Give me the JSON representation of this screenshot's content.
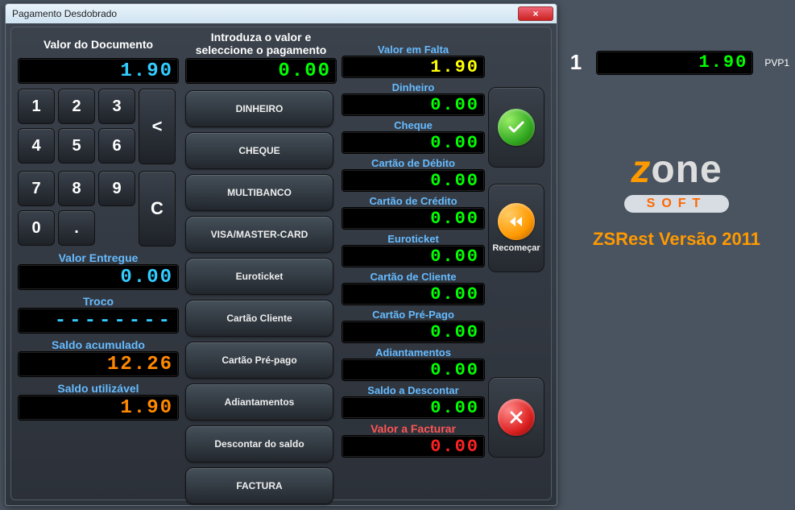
{
  "window": {
    "title": "Pagamento Desdobrado",
    "close": "×"
  },
  "col1": {
    "header": "Valor do Documento",
    "doc_value": "1.90",
    "keys": {
      "k1": "1",
      "k2": "2",
      "k3": "3",
      "k4": "4",
      "k5": "5",
      "k6": "6",
      "k7": "7",
      "k8": "8",
      "k9": "9",
      "k0": "0",
      "kdot": ".",
      "back": "<",
      "clear": "C"
    },
    "delivered_label": "Valor Entregue",
    "delivered_value": "0.00",
    "change_label": "Troco",
    "change_value": "--------",
    "accum_label": "Saldo acumulado",
    "accum_value": "12.26",
    "usable_label": "Saldo utilizável",
    "usable_value": "1.90"
  },
  "col2": {
    "header_line1": "Introduza o valor e",
    "header_line2": "seleccione o pagamento",
    "input_value": "0.00",
    "buttons": {
      "b1": "DINHEIRO",
      "b2": "CHEQUE",
      "b3": "MULTIBANCO",
      "b4": "VISA/MASTER-CARD",
      "b5": "Euroticket",
      "b6": "Cartão Cliente",
      "b7": "Cartão Pré-pago",
      "b8": "Adiantamentos",
      "b9": "Descontar do saldo",
      "b10": "FACTURA"
    }
  },
  "col3": {
    "rows": [
      {
        "label": "Valor em Falta",
        "value": "1.90",
        "color": "yellow"
      },
      {
        "label": "Dinheiro",
        "value": "0.00",
        "color": "green"
      },
      {
        "label": "Cheque",
        "value": "0.00",
        "color": "green"
      },
      {
        "label": "Cartão de Débito",
        "value": "0.00",
        "color": "green"
      },
      {
        "label": "Cartão de Crédito",
        "value": "0.00",
        "color": "green"
      },
      {
        "label": "Euroticket",
        "value": "0.00",
        "color": "green"
      },
      {
        "label": "Cartão de Cliente",
        "value": "0.00",
        "color": "green"
      },
      {
        "label": "Cartão Pré-Pago",
        "value": "0.00",
        "color": "green"
      },
      {
        "label": "Adiantamentos",
        "value": "0.00",
        "color": "green"
      },
      {
        "label": "Saldo a Descontar",
        "value": "0.00",
        "color": "green"
      },
      {
        "label": "Valor a Facturar",
        "value": "0.00",
        "color": "red",
        "labelred": true
      }
    ]
  },
  "col4": {
    "confirm": "",
    "restart": "Recomeçar",
    "cancel": ""
  },
  "side": {
    "index": "1",
    "value": "1.90",
    "pvp": "PVP1",
    "brand_z": "z",
    "brand_one": "one",
    "brand_soft": "SOFT",
    "version": "ZSRest Versão 2011"
  }
}
